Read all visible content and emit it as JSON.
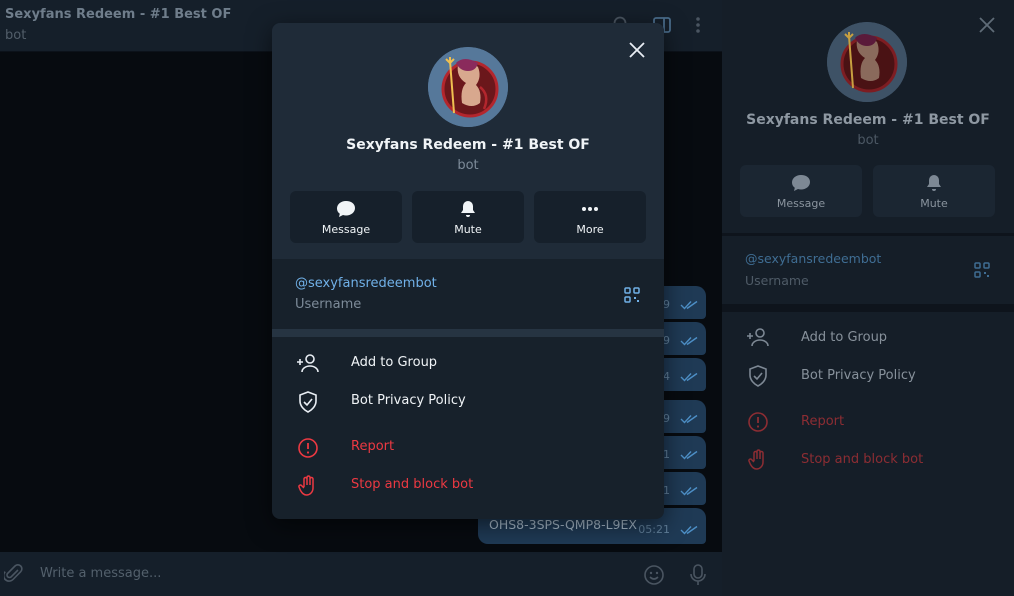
{
  "chat": {
    "title": "Sexyfans Redeem - #1 Best OF",
    "subtitle": "bot",
    "composer_placeholder": "Write a message...",
    "messages": [
      {
        "time": "05:19"
      },
      {
        "time": "05:19"
      },
      {
        "time": "05:04"
      },
      {
        "time": "05:19"
      },
      {
        "time": "05:21"
      },
      {
        "time": "05:21"
      },
      {
        "text": "OHS8-3SPS-QMP8-L9EX",
        "time": "05:21"
      }
    ]
  },
  "modal": {
    "name": "Sexyfans Redeem - #1 Best OF",
    "subtitle": "bot",
    "buttons": {
      "message": "Message",
      "mute": "Mute",
      "more": "More"
    },
    "username": "@sexyfansredeembot",
    "username_label": "Username",
    "actions": {
      "add_to_group": "Add to Group",
      "privacy": "Bot Privacy Policy",
      "report": "Report",
      "stop": "Stop and block bot"
    }
  },
  "side": {
    "name": "Sexyfans Redeem - #1 Best OF",
    "subtitle": "bot",
    "buttons": {
      "message": "Message",
      "mute": "Mute"
    },
    "username": "@sexyfansredeembot",
    "username_label": "Username",
    "actions": {
      "add_to_group": "Add to Group",
      "privacy": "Bot Privacy Policy",
      "report": "Report",
      "stop": "Stop and block bot"
    }
  },
  "colors": {
    "accent": "#71b1e8",
    "danger": "#ec3942",
    "modal_bg": "#17212b",
    "modal_header": "#1f2b38"
  },
  "icons": [
    "search-icon",
    "sidebar-toggle-icon",
    "kebab-icon",
    "attach-icon",
    "emoji-icon",
    "mic-icon",
    "close-icon",
    "message-icon",
    "bell-icon",
    "more-icon",
    "qr-code-icon",
    "add-user-icon",
    "shield-check-icon",
    "alert-circle-icon",
    "hand-stop-icon",
    "double-check-icon"
  ]
}
